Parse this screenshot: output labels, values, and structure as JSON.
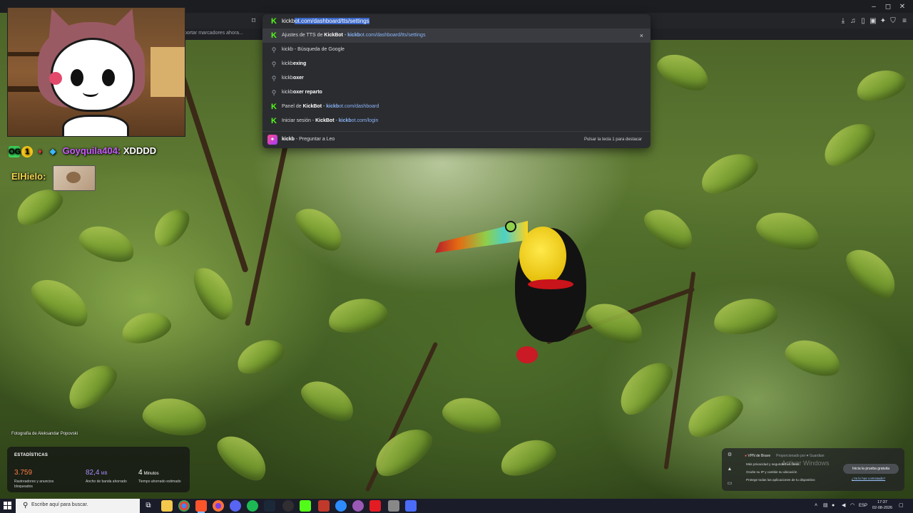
{
  "browser": {
    "omnibox": {
      "typed_prefix": "kickb",
      "autocomplete_selected": "ot.com/dashboard/tts/settings",
      "suggestions": [
        {
          "title": "Ajustes de TTS de ",
          "title_bold": "KickBot",
          "sep": " - ",
          "url_bold": "kickb",
          "url_rest": "ot.com/dashboard/tts/settings",
          "icon": "kick-favicon",
          "close": "×"
        },
        {
          "title_bold": "kickb",
          "rest": " - Búsqueda de Google",
          "icon": "search-icon"
        },
        {
          "title": "kickb",
          "rest_bold": "exing",
          "icon": "search-icon"
        },
        {
          "title": "kickb",
          "rest_bold": "oxer",
          "icon": "search-icon"
        },
        {
          "title": "kickb",
          "rest_bold": "oxer reparto",
          "icon": "search-icon"
        },
        {
          "title": "Panel de ",
          "title_bold": "KickBot",
          "sep": " - ",
          "url_bold": "kickb",
          "url_rest": "ot.com/dashboard",
          "icon": "kick-favicon"
        },
        {
          "title": "Iniciar sesión - ",
          "title_bold": "KickBot",
          "sep": " - ",
          "url_bold": "kickb",
          "url_rest": "ot.com/login",
          "icon": "kick-favicon"
        }
      ],
      "leo": {
        "query": "kickb",
        "label": " - Preguntar a Leo",
        "hint": "Pulsar la tecla 1 para destacar"
      }
    },
    "bookmarks_bar_text": "portar marcadores ahora..."
  },
  "stream_overlay": {
    "chat": [
      {
        "user": "Goyquila404:",
        "message": "XDDDD",
        "user_color": "#c85bff"
      },
      {
        "user": "ElHielo:",
        "message": "",
        "user_color": "#f1d24f"
      }
    ]
  },
  "newtab": {
    "photo_credit": "Fotografía de Aleksandar Popovski",
    "stats": {
      "title": "ESTADÍSTICAS",
      "items": [
        {
          "value": "3.759",
          "unit": "",
          "desc": "Rastreadores y anuncios bloqueados",
          "color": "#ff7a45"
        },
        {
          "value": "82,4",
          "unit": "MB",
          "desc": "Ancho de banda ahorrado",
          "color": "#a78bff"
        },
        {
          "value": "4",
          "unit": "Minutos",
          "desc": "Tiempo ahorrado estimado",
          "color": "#ffffff"
        }
      ]
    },
    "vpn": {
      "title": "VPN de Brave",
      "powered_by": "Proporcionado por ♥ Guardian",
      "items": [
        "Más privacidad y seguridad en línea",
        "Oculte su IP y cambie su ubicación",
        "Protege todas las aplicaciones de tu dispositivo"
      ],
      "cta": "Inicia la prueba gratuita",
      "link": "¿Ya lo has contratado?"
    },
    "windows_watermark": "Activar Windows"
  },
  "taskbar": {
    "search_placeholder": "Escribe aquí para buscar.",
    "language": "ESP",
    "time": "17:37",
    "date": "02-08-2026"
  }
}
